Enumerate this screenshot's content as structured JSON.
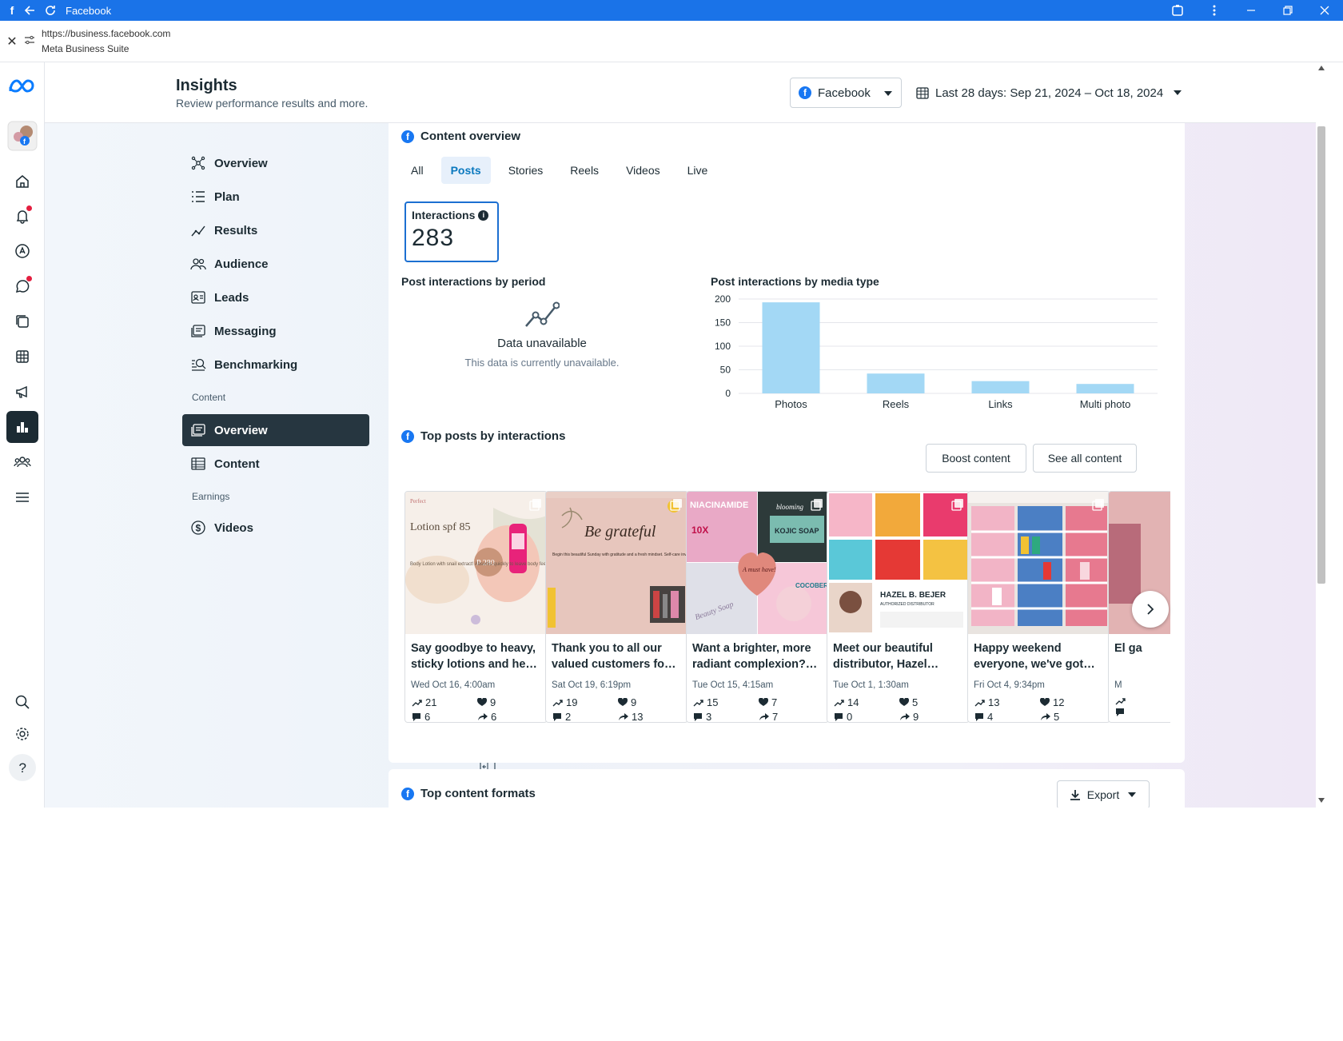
{
  "browser": {
    "window_title": "Facebook",
    "url": "https://business.facebook.com",
    "page_title": "Meta Business Suite"
  },
  "header": {
    "title": "Insights",
    "subtitle": "Review performance results and more.",
    "platform": "Facebook",
    "date_range": "Last 28 days: Sep 21, 2024 – Oct 18, 2024"
  },
  "sidenav": {
    "items": [
      {
        "label": "Overview",
        "icon": "overview-icon"
      },
      {
        "label": "Plan",
        "icon": "plan-icon"
      },
      {
        "label": "Results",
        "icon": "results-icon"
      },
      {
        "label": "Audience",
        "icon": "audience-icon"
      },
      {
        "label": "Leads",
        "icon": "leads-icon"
      },
      {
        "label": "Messaging",
        "icon": "messaging-icon"
      },
      {
        "label": "Benchmarking",
        "icon": "benchmarking-icon"
      }
    ],
    "content_section": "Content",
    "content_items": [
      {
        "label": "Overview",
        "active": true
      },
      {
        "label": "Content"
      }
    ],
    "earnings_section": "Earnings",
    "earnings_items": [
      {
        "label": "Videos"
      }
    ]
  },
  "content_overview": {
    "title": "Content overview",
    "tabs": [
      "All",
      "Posts",
      "Stories",
      "Reels",
      "Videos",
      "Live"
    ],
    "active_tab": "Posts",
    "metric": {
      "label": "Interactions",
      "value": "283"
    },
    "by_period": {
      "title": "Post interactions by period",
      "unavailable_title": "Data unavailable",
      "unavailable_sub": "This data is currently unavailable."
    },
    "by_media_title": "Post interactions by media type"
  },
  "chart_data": {
    "type": "bar",
    "title": "Post interactions by media type",
    "categories": [
      "Photos",
      "Reels",
      "Links",
      "Multi photo"
    ],
    "values": [
      193,
      42,
      26,
      20
    ],
    "ylim": [
      0,
      200
    ],
    "yticks": [
      "0",
      "50",
      "100",
      "150",
      "200"
    ],
    "color": "#a3d8f5",
    "grid": true
  },
  "top_posts": {
    "title": "Top posts by interactions",
    "boost_label": "Boost content",
    "see_all_label": "See all content",
    "posts": [
      {
        "text": "Say goodbye to heavy, sticky lotions and he…",
        "date": "Wed Oct 16, 4:00am",
        "reach": "21",
        "likes": "9",
        "comments": "6",
        "shares": "6"
      },
      {
        "text": "Thank you to all our valued customers fo…",
        "date": "Sat Oct 19, 6:19pm",
        "reach": "19",
        "likes": "9",
        "comments": "2",
        "shares": "13"
      },
      {
        "text": "Want a brighter, more radiant complexion?…",
        "date": "Tue Oct 15, 4:15am",
        "reach": "15",
        "likes": "7",
        "comments": "3",
        "shares": "7"
      },
      {
        "text": "Meet our beautiful distributor, Hazel…",
        "date": "Tue Oct 1, 1:30am",
        "reach": "14",
        "likes": "5",
        "comments": "0",
        "shares": "9"
      },
      {
        "text": "Happy weekend everyone, we've got…",
        "date": "Fri Oct 4, 9:34pm",
        "reach": "13",
        "likes": "12",
        "comments": "4",
        "shares": "5"
      },
      {
        "text": "El ga",
        "date": "M",
        "reach": "",
        "likes": "",
        "comments": "",
        "shares": ""
      }
    ]
  },
  "thumb_text": {
    "p1_brand": "Perfect",
    "p1_title": "Lotion spf 85",
    "p1_price": "P 280",
    "p1_body": "Body Lotion with snail extract! Absorbs quickly to leave body feeling soft and smooth",
    "p2_title": "Be grateful",
    "p2_body": "Begin this beautiful Sunday with gratitude and a fresh mindset. Self-care involves feeling great, not just looking good. Nourish your body, mind, and soul today; you deserve all the love and happiness life offers.",
    "p3_tl": "NIACINAMIDE",
    "p3_tl2": "10X",
    "p3_tr": "KOJIC SOAP",
    "p3_tr_brand": "blooming",
    "p3_heart": "A must have!",
    "p3_bl": "Beauty Soap",
    "p3_br": "COCOBERRY",
    "p4_name": "HAZEL B. BEJER",
    "p4_role": "AUTHORIZED DISTRIBUTOR"
  },
  "top_formats": {
    "title": "Top content formats",
    "export_label": "Export"
  }
}
